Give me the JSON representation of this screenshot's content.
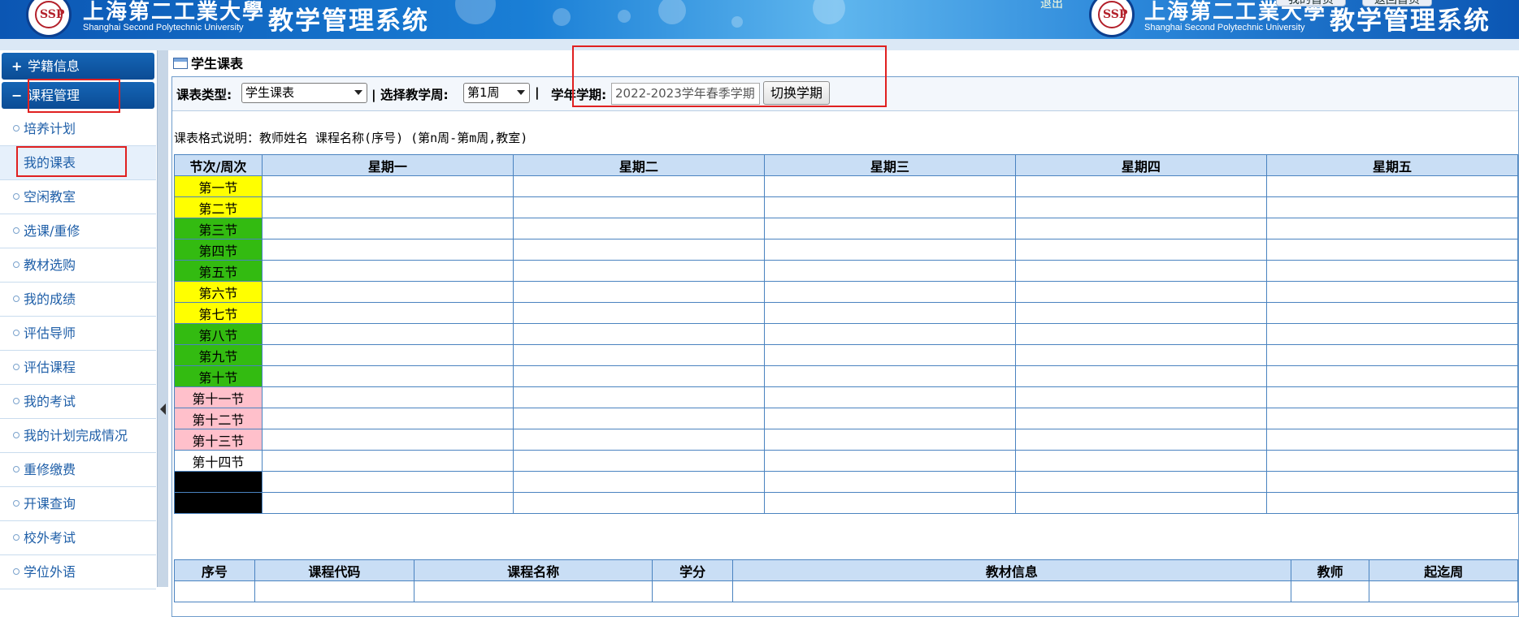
{
  "header": {
    "uni_name_cn": "上海第二工業大學",
    "uni_name_en": "Shanghai Second Polytechnic University",
    "system_title": "教学管理系统",
    "logo_text": "SSP",
    "top_tabs": [
      "我的首页",
      "返回首页"
    ],
    "top_link": "退出"
  },
  "sidebar": {
    "sections": [
      {
        "symbol": "+",
        "label": "学籍信息"
      },
      {
        "symbol": "−",
        "label": "课程管理"
      }
    ],
    "items": [
      {
        "label": "培养计划"
      },
      {
        "label": "我的课表"
      },
      {
        "label": "空闲教室"
      },
      {
        "label": "选课/重修"
      },
      {
        "label": "教材选购"
      },
      {
        "label": "我的成绩"
      },
      {
        "label": "评估导师"
      },
      {
        "label": "评估课程"
      },
      {
        "label": "我的考试"
      },
      {
        "label": "我的计划完成情况"
      },
      {
        "label": "重修缴费"
      },
      {
        "label": "开课查询"
      },
      {
        "label": "校外考试"
      },
      {
        "label": "学位外语"
      }
    ]
  },
  "panel": {
    "title": "学生课表",
    "toolbar": {
      "type_label": "课表类型:",
      "type_value": "学生课表",
      "week_label": "| 选择教学周:",
      "week_value": "第1周",
      "sep": "|",
      "term_label": "学年学期:",
      "term_value": "2022-2023学年春季学期",
      "switch_button": "切换学期"
    },
    "format_note": "课表格式说明：教师姓名 课程名称(序号) (第n周-第m周,教室)"
  },
  "schedule": {
    "corner": "节次/周次",
    "days": [
      "星期一",
      "星期二",
      "星期三",
      "星期四",
      "星期五"
    ],
    "periods": [
      {
        "label": "第一节",
        "color": "#ffff00"
      },
      {
        "label": "第二节",
        "color": "#ffff00"
      },
      {
        "label": "第三节",
        "color": "#33bb11"
      },
      {
        "label": "第四节",
        "color": "#33bb11"
      },
      {
        "label": "第五节",
        "color": "#33bb11"
      },
      {
        "label": "第六节",
        "color": "#ffff00"
      },
      {
        "label": "第七节",
        "color": "#ffff00"
      },
      {
        "label": "第八节",
        "color": "#33bb11"
      },
      {
        "label": "第九节",
        "color": "#33bb11"
      },
      {
        "label": "第十节",
        "color": "#33bb11"
      },
      {
        "label": "第十一节",
        "color": "#ffc0cb"
      },
      {
        "label": "第十二节",
        "color": "#ffc0cb"
      },
      {
        "label": "第十三节",
        "color": "#ffc0cb"
      },
      {
        "label": "第十四节",
        "color": "#ffffff"
      },
      {
        "label": "",
        "color": "#000000"
      },
      {
        "label": "",
        "color": "#000000"
      }
    ]
  },
  "course_table": {
    "headers": [
      "序号",
      "课程代码",
      "课程名称",
      "学分",
      "教材信息",
      "教师",
      "起迄周"
    ]
  }
}
